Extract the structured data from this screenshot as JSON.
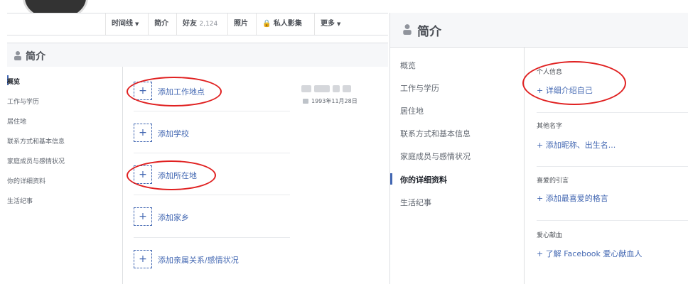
{
  "left_panel": {
    "nav_tabs": [
      {
        "label": "时间线",
        "caret": "▼"
      },
      {
        "label": "简介"
      },
      {
        "label": "好友",
        "count": "2,124"
      },
      {
        "label": "照片"
      },
      {
        "label": "🔒 私人影集"
      },
      {
        "label": "更多",
        "caret": "▼"
      }
    ],
    "section_title": "简介",
    "sidebar": [
      "概览",
      "工作与学历",
      "居住地",
      "联系方式和基本信息",
      "家庭成员与感情状况",
      "你的详细资料",
      "生活纪事"
    ],
    "add_items": [
      "添加工作地点",
      "添加学校",
      "添加所在地",
      "添加家乡",
      "添加亲属关系/感情状况"
    ],
    "plus_icon": "+",
    "birthday": "1993年11月28日"
  },
  "right_panel": {
    "section_title": "简介",
    "sidebar": [
      "概览",
      "工作与学历",
      "居住地",
      "联系方式和基本信息",
      "家庭成员与感情状况",
      "你的详细资料",
      "生活纪事"
    ],
    "sections": [
      {
        "heading": "个人信息",
        "link": "+ 详细介绍自己"
      },
      {
        "heading": "其他名字",
        "link": "+ 添加昵称、出生名..."
      },
      {
        "heading": "喜爱的引言",
        "link": "+ 添加最喜爱的格言"
      },
      {
        "heading": "爱心献血",
        "link": "+ 了解 Facebook 爱心献血人"
      }
    ]
  },
  "colors": {
    "link": "#4267b2",
    "annotation": "#e02020"
  }
}
